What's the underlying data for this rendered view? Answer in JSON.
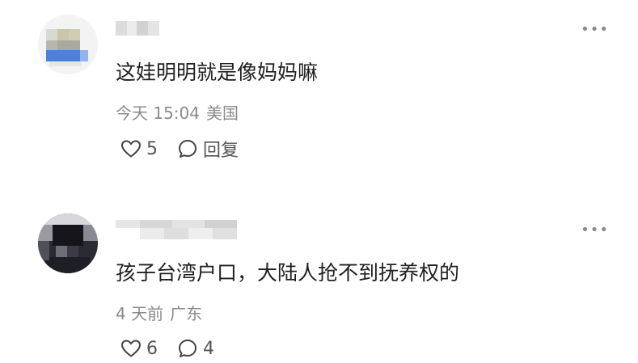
{
  "comments": [
    {
      "avatar": {
        "blurred": true,
        "colors": [
          "#e2e2e2",
          "#c8c6a2",
          "#4a82d8",
          "#7aa6e8"
        ]
      },
      "username_blurred": true,
      "more_icon": "more-horizontal-icon",
      "text": "这娃明明就是像妈妈嘛",
      "time": "今天 15:04",
      "location": "美国",
      "like_icon": "heart-icon",
      "likes": "5",
      "reply_icon": "comment-bubble-icon",
      "reply_label": "回复"
    },
    {
      "avatar": {
        "blurred": true,
        "colors": [
          "#1c1c24",
          "#3a3a44",
          "#e6e6e6",
          "#5c5c68"
        ]
      },
      "username_blurred": true,
      "more_icon": "more-horizontal-icon",
      "text": "孩子台湾户口，大陆人抢不到抚养权的",
      "time": "4 天前",
      "location": "广东",
      "like_icon": "heart-icon",
      "likes": "6",
      "reply_icon": "comment-bubble-icon",
      "reply_count": "4"
    }
  ]
}
